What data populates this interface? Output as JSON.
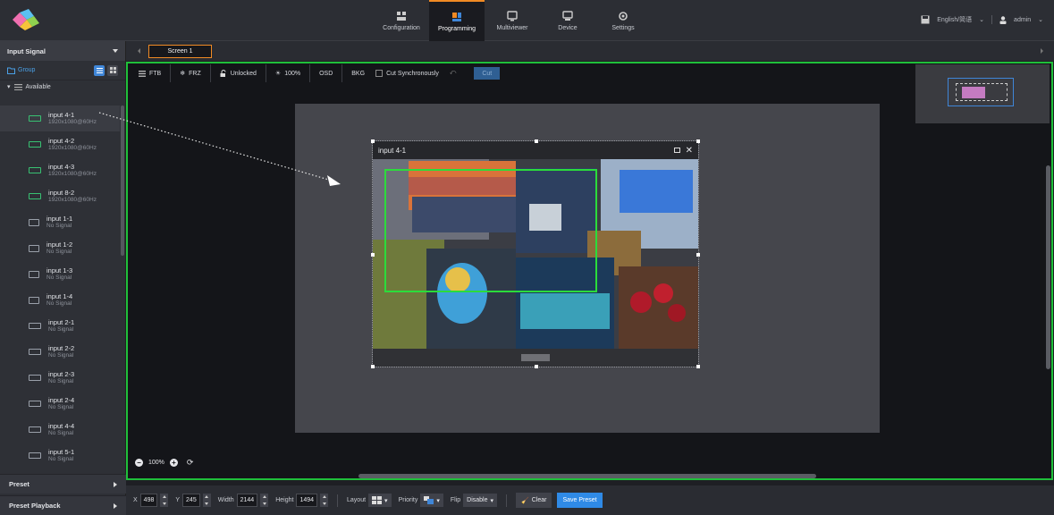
{
  "topbar": {
    "nav": [
      {
        "label": "Configuration",
        "icon": "grid-icon"
      },
      {
        "label": "Programming",
        "icon": "layout-icon",
        "active": true
      },
      {
        "label": "Multiviewer",
        "icon": "monitor-icon"
      },
      {
        "label": "Device",
        "icon": "device-icon"
      },
      {
        "label": "Settings",
        "icon": "gear-icon"
      }
    ],
    "language": "English/简语",
    "user": "admin"
  },
  "sidebar": {
    "header": "Input Signal",
    "group_label": "Group",
    "available_label": "Available",
    "items": [
      {
        "name": "input 4-1",
        "status": "1920x1080@60Hz",
        "live": true
      },
      {
        "name": "input 4-2",
        "status": "1920x1080@60Hz",
        "live": true
      },
      {
        "name": "input 4-3",
        "status": "1920x1080@60Hz",
        "live": true
      },
      {
        "name": "input 8-2",
        "status": "1920x1080@60Hz",
        "live": true
      },
      {
        "name": "input 1-1",
        "status": "No Signal",
        "live": false
      },
      {
        "name": "input 1-2",
        "status": "No Signal",
        "live": false
      },
      {
        "name": "input 1-3",
        "status": "No Signal",
        "live": false
      },
      {
        "name": "input 1-4",
        "status": "No Signal",
        "live": false
      },
      {
        "name": "input 2-1",
        "status": "No Signal",
        "live": false
      },
      {
        "name": "input 2-2",
        "status": "No Signal",
        "live": false
      },
      {
        "name": "input 2-3",
        "status": "No Signal",
        "live": false
      },
      {
        "name": "input 2-4",
        "status": "No Signal",
        "live": false
      },
      {
        "name": "input 4-4",
        "status": "No Signal",
        "live": false
      },
      {
        "name": "input 5-1",
        "status": "No Signal",
        "live": false
      }
    ],
    "preset_label": "Preset",
    "playback_label": "Preset Playback"
  },
  "screen_tab": "Screen 1",
  "toolbar": {
    "ftb": "FTB",
    "frz": "FRZ",
    "lock": "Unlocked",
    "brightness": "100%",
    "osd": "OSD",
    "bkg": "BKG",
    "cut_sync": "Cut Synchronously",
    "cut": "Cut"
  },
  "window": {
    "title": "input 4-1"
  },
  "zoom": "100%",
  "bottom": {
    "x_label": "X",
    "x": "498",
    "y_label": "Y",
    "y": "245",
    "w_label": "Width",
    "w": "2144",
    "h_label": "Height",
    "h": "1494",
    "layout_label": "Layout",
    "priority_label": "Priority",
    "flip_label": "Flip",
    "flip": "Disable",
    "clear": "Clear",
    "save": "Save Preset"
  },
  "colors": {
    "accent": "#f08a24",
    "selection": "#1fbf3a",
    "primary": "#2f8ae6"
  }
}
